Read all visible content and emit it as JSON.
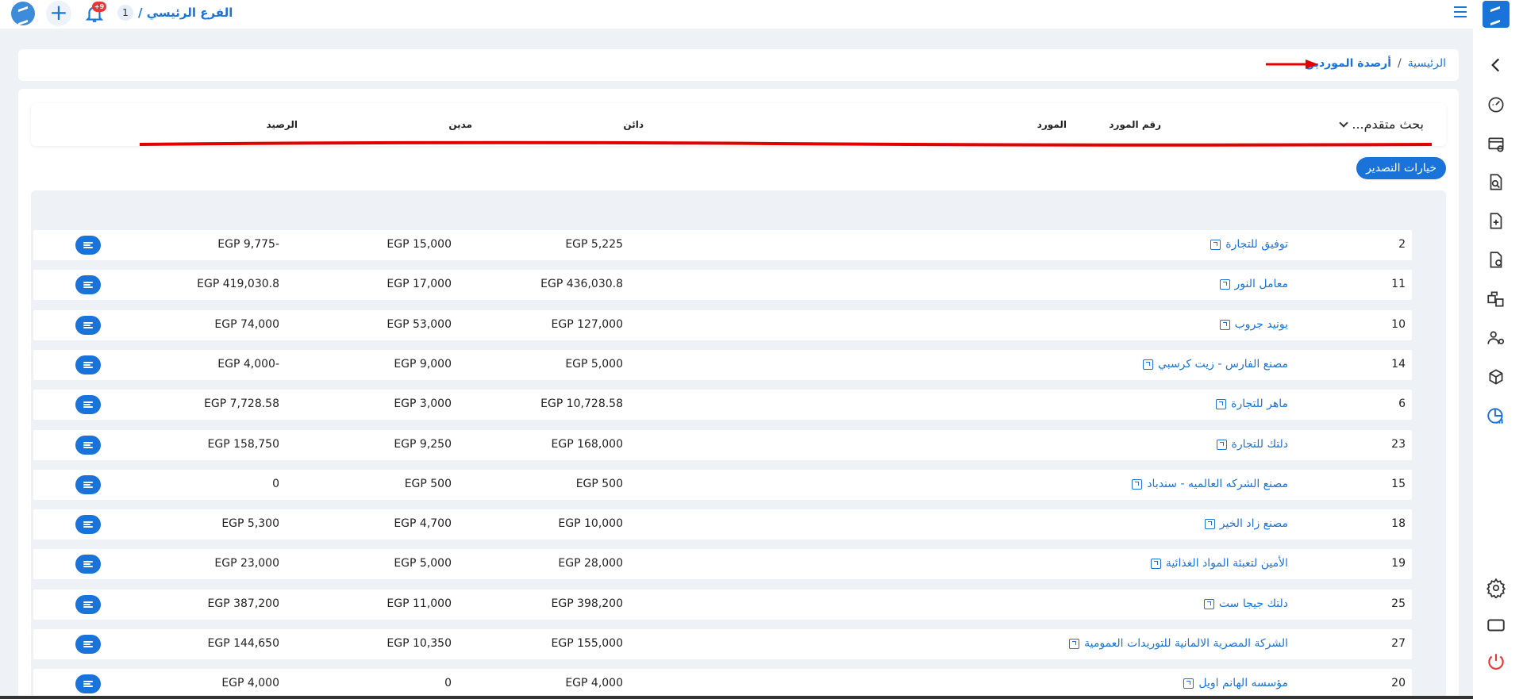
{
  "topbar": {
    "notification_badge": "+9",
    "branch_number": "1",
    "branch_name": "الفرع الرئيسي /"
  },
  "breadcrumb": {
    "home": "الرئيسية",
    "separator": "/",
    "current": "أرصدة الموردين"
  },
  "search": {
    "label": "بحث متقدم..."
  },
  "export_button": "خيارات التصدير",
  "table": {
    "headers": {
      "number": "رقم المورد",
      "supplier": "المورد",
      "credit": "دائن",
      "debit": "مدين",
      "balance": "الرصيد"
    },
    "rows": [
      {
        "number": "2",
        "supplier": "توفيق للتجارة",
        "credit": "EGP 5,225",
        "debit": "EGP 15,000",
        "balance": "EGP 9,775-"
      },
      {
        "number": "11",
        "supplier": "معامل النور",
        "credit": "EGP 436,030.8",
        "debit": "EGP 17,000",
        "balance": "EGP 419,030.8"
      },
      {
        "number": "10",
        "supplier": "يونيد جروب",
        "credit": "EGP 127,000",
        "debit": "EGP 53,000",
        "balance": "EGP 74,000"
      },
      {
        "number": "14",
        "supplier": "مصنع الفارس - زيت كرسبي",
        "credit": "EGP 5,000",
        "debit": "EGP 9,000",
        "balance": "EGP 4,000-"
      },
      {
        "number": "6",
        "supplier": "ماهر للتجارة",
        "credit": "EGP 10,728.58",
        "debit": "EGP 3,000",
        "balance": "EGP 7,728.58"
      },
      {
        "number": "23",
        "supplier": "دلتك للتجارة",
        "credit": "EGP 168,000",
        "debit": "EGP 9,250",
        "balance": "EGP 158,750"
      },
      {
        "number": "15",
        "supplier": "مصنع الشركه العالميه - سندباد",
        "credit": "EGP 500",
        "debit": "EGP 500",
        "balance": "0"
      },
      {
        "number": "18",
        "supplier": "مصنع زاد الخير",
        "credit": "EGP 10,000",
        "debit": "EGP 4,700",
        "balance": "EGP 5,300"
      },
      {
        "number": "19",
        "supplier": "الأمين لتعبئة المواد الغذائية",
        "credit": "EGP 28,000",
        "debit": "EGP 5,000",
        "balance": "EGP 23,000"
      },
      {
        "number": "25",
        "supplier": "دلتك جيجا ست",
        "credit": "EGP 398,200",
        "debit": "EGP 11,000",
        "balance": "EGP 387,200"
      },
      {
        "number": "27",
        "supplier": "الشركة المصرية الالمانية للتوريدات العمومية",
        "credit": "EGP 155,000",
        "debit": "EGP 10,350",
        "balance": "EGP 144,650"
      },
      {
        "number": "20",
        "supplier": "مؤسسه الهانم اويل",
        "credit": "EGP 4,000",
        "debit": "0",
        "balance": "EGP 4,000"
      }
    ]
  },
  "colors": {
    "accent": "#1a73d9",
    "annotation": "#e00000"
  }
}
